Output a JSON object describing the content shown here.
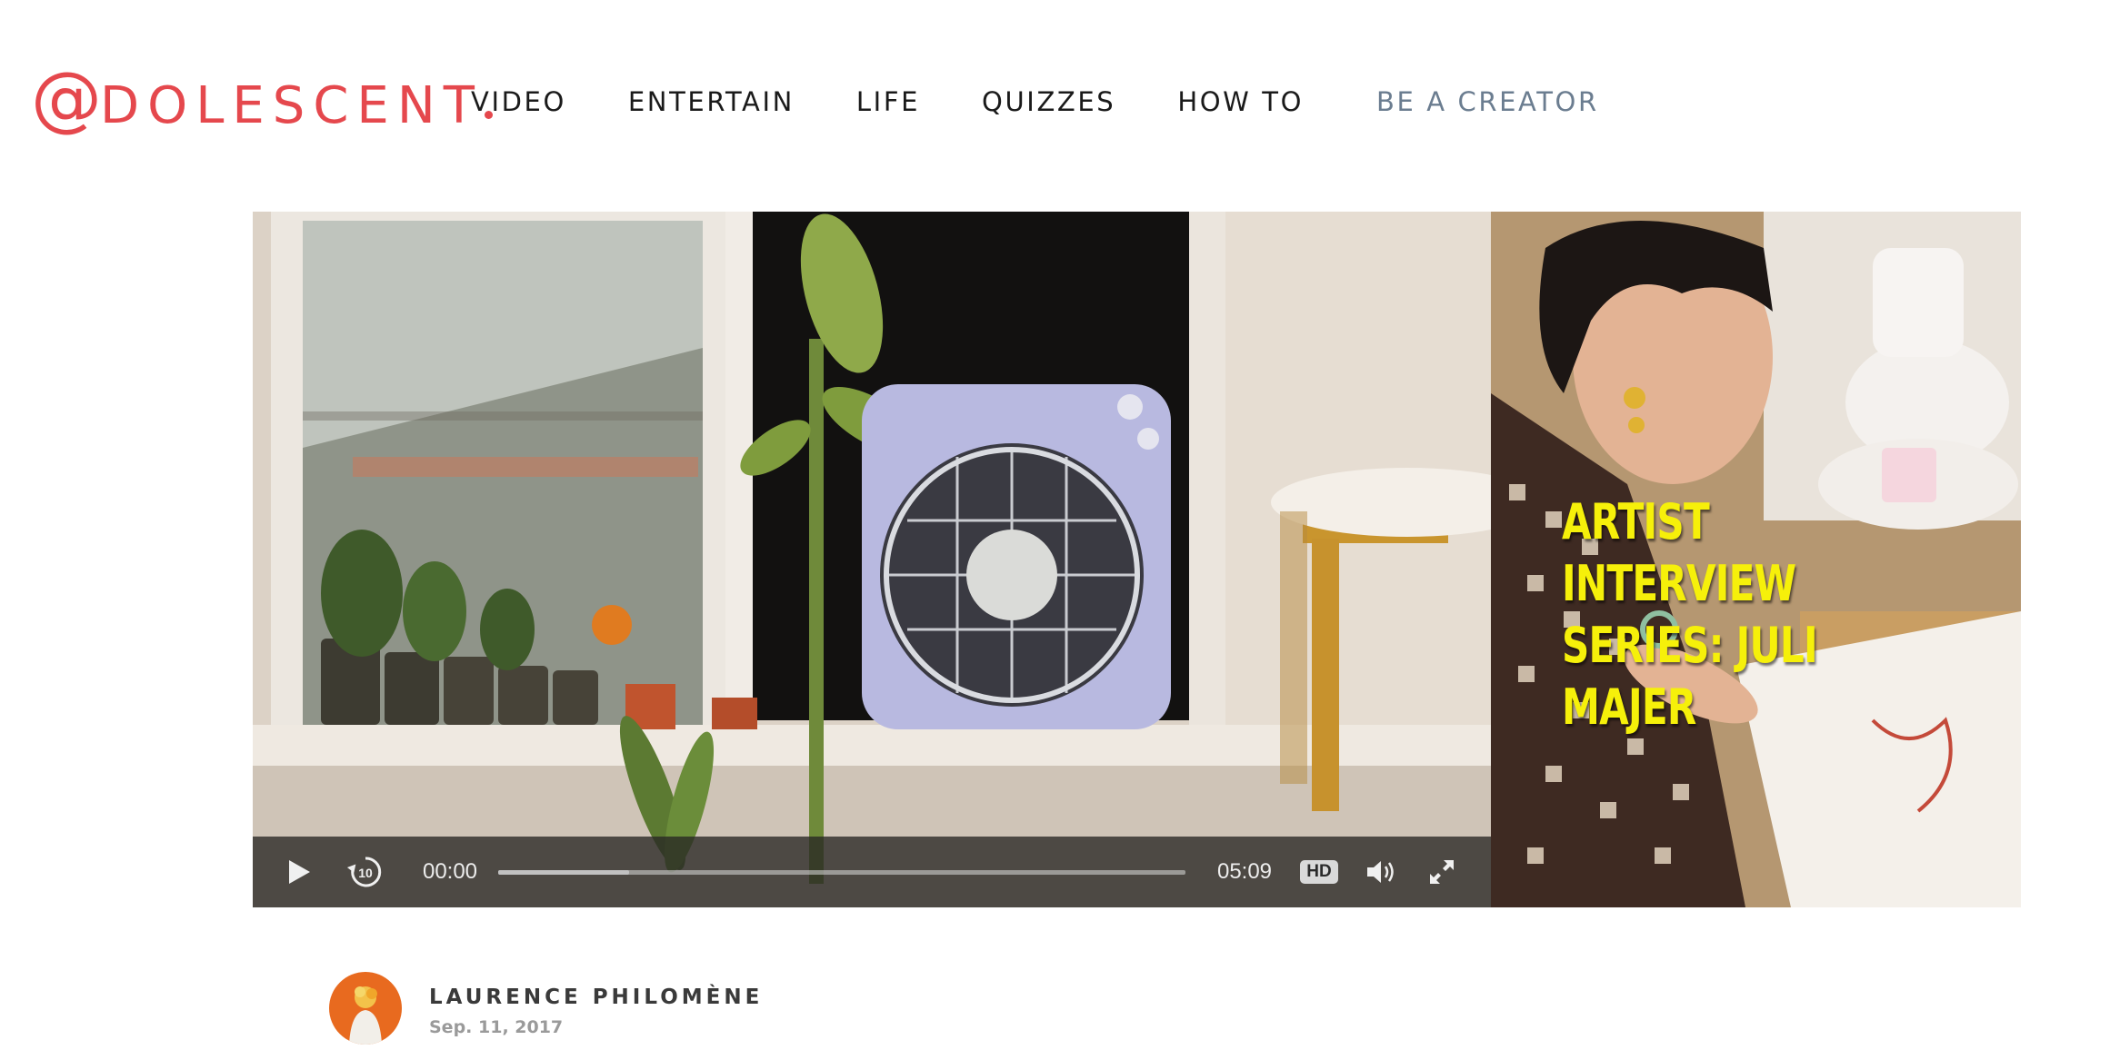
{
  "brand": {
    "at_symbol": "@",
    "wordmark": "DOLESCENT",
    "color": "#e5484d"
  },
  "nav": {
    "items": [
      {
        "label": "VIDEO"
      },
      {
        "label": "ENTERTAIN"
      },
      {
        "label": "LIFE"
      },
      {
        "label": "QUIZZES"
      },
      {
        "label": "HOW TO"
      }
    ],
    "creator_label": "BE A CREATOR",
    "creator_color": "#6b7d90"
  },
  "player": {
    "current_time": "00:00",
    "duration": "05:09",
    "quality_badge": "HD",
    "played_fraction": 0,
    "buffered_fraction": 0.19,
    "icons": {
      "play": "play-icon",
      "rewind": "rewind-10-icon",
      "rewind_seconds": "10",
      "volume": "volume-icon",
      "fullscreen": "fullscreen-icon"
    }
  },
  "feature": {
    "overlay_title": "ARTIST INTERVIEW\nSERIES: JULI MAJER",
    "overlay_color": "#f6f00a"
  },
  "byline": {
    "author": "LAURENCE PHILOMÈNE",
    "date": "Sep. 11, 2017"
  }
}
